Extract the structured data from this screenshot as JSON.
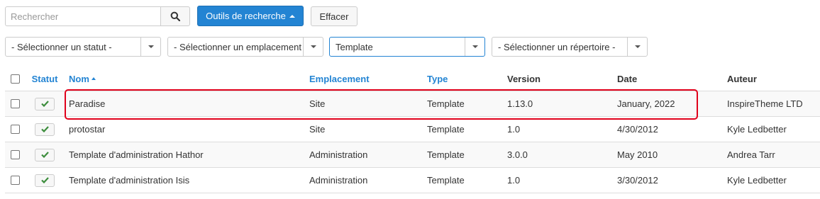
{
  "toolbar": {
    "search_placeholder": "Rechercher",
    "search_tools_label": "Outils de recherche",
    "clear_label": "Effacer"
  },
  "filters": {
    "status": "- Sélectionner un statut -",
    "location": "- Sélectionner un emplacement -",
    "type": "Template",
    "directory": "- Sélectionner un répertoire -"
  },
  "table": {
    "headers": {
      "status": "Statut",
      "name": "Nom",
      "location": "Emplacement",
      "type": "Type",
      "version": "Version",
      "date": "Date",
      "author": "Auteur"
    },
    "sort": {
      "column": "name",
      "direction": "asc"
    },
    "rows": [
      {
        "name": "Paradise",
        "location": "Site",
        "type": "Template",
        "version": "1.13.0",
        "date": "January, 2022",
        "author": "InspireTheme LTD",
        "enabled": true
      },
      {
        "name": "protostar",
        "location": "Site",
        "type": "Template",
        "version": "1.0",
        "date": "4/30/2012",
        "author": "Kyle Ledbetter",
        "enabled": true
      },
      {
        "name": "Template d'administration Hathor",
        "location": "Administration",
        "type": "Template",
        "version": "3.0.0",
        "date": "May 2010",
        "author": "Andrea Tarr",
        "enabled": true
      },
      {
        "name": "Template d'administration Isis",
        "location": "Administration",
        "type": "Template",
        "version": "1.0",
        "date": "3/30/2012",
        "author": "Kyle Ledbetter",
        "enabled": true
      }
    ]
  },
  "icons": {
    "search": "search-icon",
    "status": "check-icon"
  },
  "colors": {
    "primary": "#2384d3",
    "check": "#3c8d3c",
    "highlight": "#e0001b"
  }
}
